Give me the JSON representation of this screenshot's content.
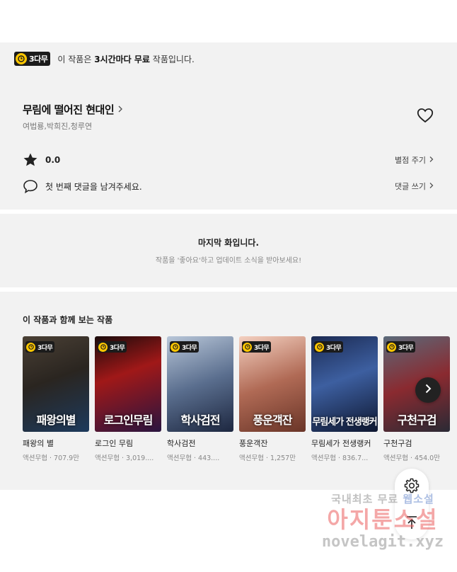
{
  "banner": {
    "badge": "3다무",
    "msg_pre": "이 작품은 ",
    "msg_bold": "3시간마다 무료",
    "msg_post": " 작품입니다."
  },
  "work": {
    "title": "무림에 떨어진 현대인",
    "authors": "여법룡,박희진,청루연",
    "rating": "0.0",
    "rate_action": "별점 주기",
    "comment_prompt": "첫 번째 댓글을 남겨주세요.",
    "comment_action": "댓글 쓰기"
  },
  "last_episode": {
    "heading": "마지막 화입니다.",
    "sub": "작품을 '좋아요'하고 업데이트 소식을 받아보세요!"
  },
  "related": {
    "title": "이 작품과 함께 보는 작품",
    "badge": "3다무",
    "items": [
      {
        "name": "패왕의 별",
        "meta": "액션무협 · 707.9만",
        "cover_text": "패왕의별"
      },
      {
        "name": "로그인 무림",
        "meta": "액션무협 · 3,019....",
        "cover_text": "로그인무림"
      },
      {
        "name": "학사검전",
        "meta": "액션무협 · 443....",
        "cover_text": "학사검전"
      },
      {
        "name": "풍운객잔",
        "meta": "액션무협 · 1,257만",
        "cover_text": "풍운객잔"
      },
      {
        "name": "무림세가 전생랭커",
        "meta": "액션무협 · 836.7...",
        "cover_text": "무림세가 전생랭커"
      },
      {
        "name": "구천구검",
        "meta": "액션무협 · 454.0만",
        "cover_text": "구천구검"
      }
    ]
  },
  "watermark": {
    "line1_a": "국내최초 무료 ",
    "line1_b": "웹소설",
    "line2": "아지툰소설",
    "line3": "novelagit.xyz"
  },
  "colors": {
    "badge_bg": "#1b1b1b",
    "badge_clock": "#ffc700",
    "section_bg": "#f2f2f2"
  },
  "icons": [
    "clock-icon",
    "heart-icon",
    "star-icon",
    "comment-icon",
    "chevron-right-icon",
    "gear-icon",
    "arrow-up-icon"
  ]
}
